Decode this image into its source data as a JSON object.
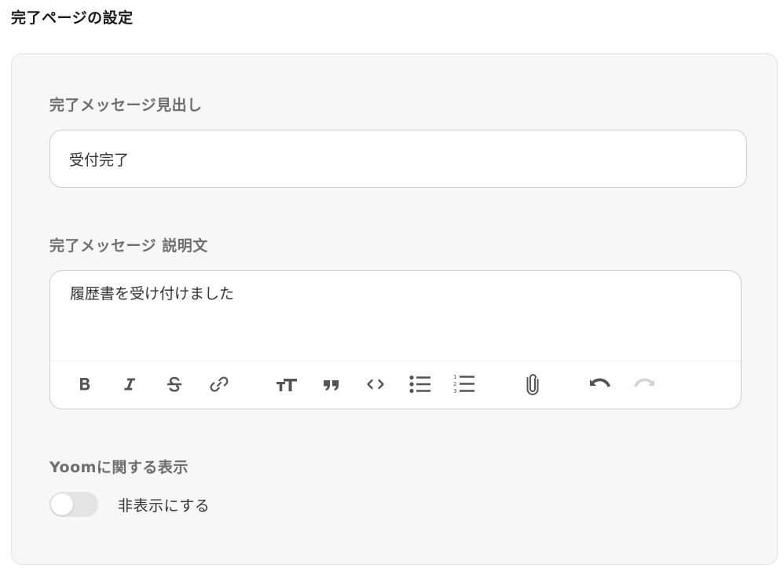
{
  "page": {
    "title": "完了ページの設定"
  },
  "heading_field": {
    "label": "完了メッセージ見出し",
    "value": "受付完了"
  },
  "description_field": {
    "label": "完了メッセージ 説明文",
    "value": "履歴書を受け付けました"
  },
  "toolbar": {
    "buttons": [
      {
        "icon": "bold-icon",
        "enabled": true
      },
      {
        "icon": "italic-icon",
        "enabled": true
      },
      {
        "icon": "strikethrough-icon",
        "enabled": true
      },
      {
        "icon": "link-icon",
        "enabled": true
      },
      {
        "icon": "text-size-icon",
        "enabled": true
      },
      {
        "icon": "quote-icon",
        "enabled": true
      },
      {
        "icon": "code-icon",
        "enabled": true
      },
      {
        "icon": "bullet-list-icon",
        "enabled": true
      },
      {
        "icon": "numbered-list-icon",
        "enabled": true
      },
      {
        "icon": "attachment-icon",
        "enabled": true
      },
      {
        "icon": "undo-icon",
        "enabled": true
      },
      {
        "icon": "redo-icon",
        "enabled": false
      }
    ]
  },
  "yoom_display": {
    "label": "Yoomに関する表示",
    "toggle_label": "非表示にする",
    "toggle_on": false
  },
  "colors": {
    "icon_active": "#555555",
    "icon_disabled": "#d4d4d4",
    "label_gray": "#6e6e6e",
    "card_bg": "#f7f7f7"
  }
}
